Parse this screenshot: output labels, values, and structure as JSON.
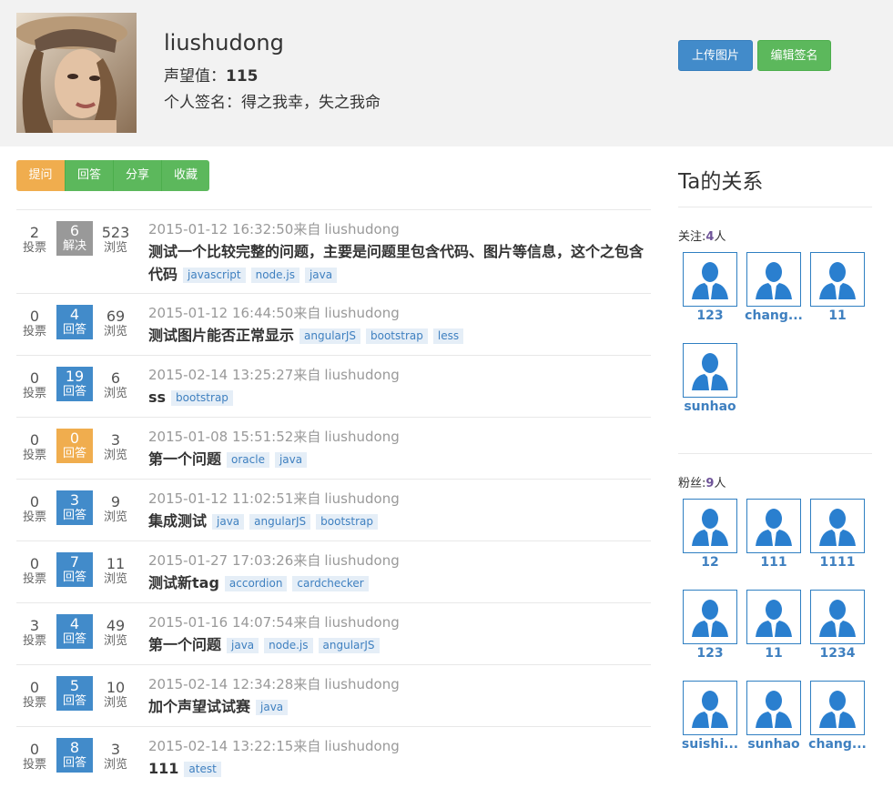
{
  "profile": {
    "username": "liushudong",
    "reputation_label": "声望值：",
    "reputation": "115",
    "signature_label": "个人签名：",
    "signature": "得之我幸，失之我命",
    "upload_label": "上传图片",
    "edit_sign_label": "编辑签名"
  },
  "tabs": [
    {
      "label": "提问",
      "active": true
    },
    {
      "label": "回答"
    },
    {
      "label": "分享"
    },
    {
      "label": "收藏"
    }
  ],
  "labels": {
    "votes": "投票",
    "views": "浏览",
    "from": "来自"
  },
  "colors": {
    "answered": "#428bca",
    "solved": "#999999",
    "zero": "#f0ad4e",
    "tag_text": "#3f80c0",
    "tag_bg": "#e5eef7"
  },
  "questions": [
    {
      "votes": "2",
      "answers": "6",
      "answer_label": "解决",
      "status": "solved",
      "views": "523",
      "time": "2015-01-12 16:32:50",
      "author": "liushudong",
      "title": "测试一个比较完整的问题，主要是问题里包含代码、图片等信息，这个之包含代码",
      "tags": [
        "javascript",
        "node.js",
        "java"
      ]
    },
    {
      "votes": "0",
      "answers": "4",
      "answer_label": "回答",
      "status": "answered",
      "views": "69",
      "time": "2015-01-12 16:44:50",
      "author": "liushudong",
      "title": "测试图片能否正常显示",
      "tags": [
        "angularJS",
        "bootstrap",
        "less"
      ]
    },
    {
      "votes": "0",
      "answers": "19",
      "answer_label": "回答",
      "status": "answered",
      "views": "6",
      "time": "2015-02-14 13:25:27",
      "author": "liushudong",
      "title": "ss",
      "tags": [
        "bootstrap"
      ]
    },
    {
      "votes": "0",
      "answers": "0",
      "answer_label": "回答",
      "status": "zero",
      "views": "3",
      "time": "2015-01-08 15:51:52",
      "author": "liushudong",
      "title": "第一个问题",
      "tags": [
        "oracle",
        "java"
      ]
    },
    {
      "votes": "0",
      "answers": "3",
      "answer_label": "回答",
      "status": "answered",
      "views": "9",
      "time": "2015-01-12 11:02:51",
      "author": "liushudong",
      "title": "集成测试",
      "tags": [
        "java",
        "angularJS",
        "bootstrap"
      ]
    },
    {
      "votes": "0",
      "answers": "7",
      "answer_label": "回答",
      "status": "answered",
      "views": "11",
      "time": "2015-01-27 17:03:26",
      "author": "liushudong",
      "title": "测试新tag",
      "tags": [
        "accordion",
        "cardchecker"
      ]
    },
    {
      "votes": "3",
      "answers": "4",
      "answer_label": "回答",
      "status": "answered",
      "views": "49",
      "time": "2015-01-16 14:07:54",
      "author": "liushudong",
      "title": "第一个问题",
      "tags": [
        "java",
        "node.js",
        "angularJS"
      ]
    },
    {
      "votes": "0",
      "answers": "5",
      "answer_label": "回答",
      "status": "answered",
      "views": "10",
      "time": "2015-02-14 12:34:28",
      "author": "liushudong",
      "title": "加个声望试试赛",
      "tags": [
        "java"
      ]
    },
    {
      "votes": "0",
      "answers": "8",
      "answer_label": "回答",
      "status": "answered",
      "views": "3",
      "time": "2015-02-14 13:22:15",
      "author": "liushudong",
      "title": "111",
      "tags": [
        "atest"
      ]
    }
  ],
  "sidebar": {
    "title": "Ta的关系",
    "following_label": "关注:",
    "following_count": "4",
    "fans_label": "粉丝:",
    "fans_count": "9",
    "person_unit": "人",
    "following": [
      "123",
      "chang...",
      "11",
      "sunhao"
    ],
    "fans": [
      "12",
      "111",
      "1111",
      "123",
      "11",
      "1234",
      "suishi...",
      "sunhao",
      "chang..."
    ]
  }
}
